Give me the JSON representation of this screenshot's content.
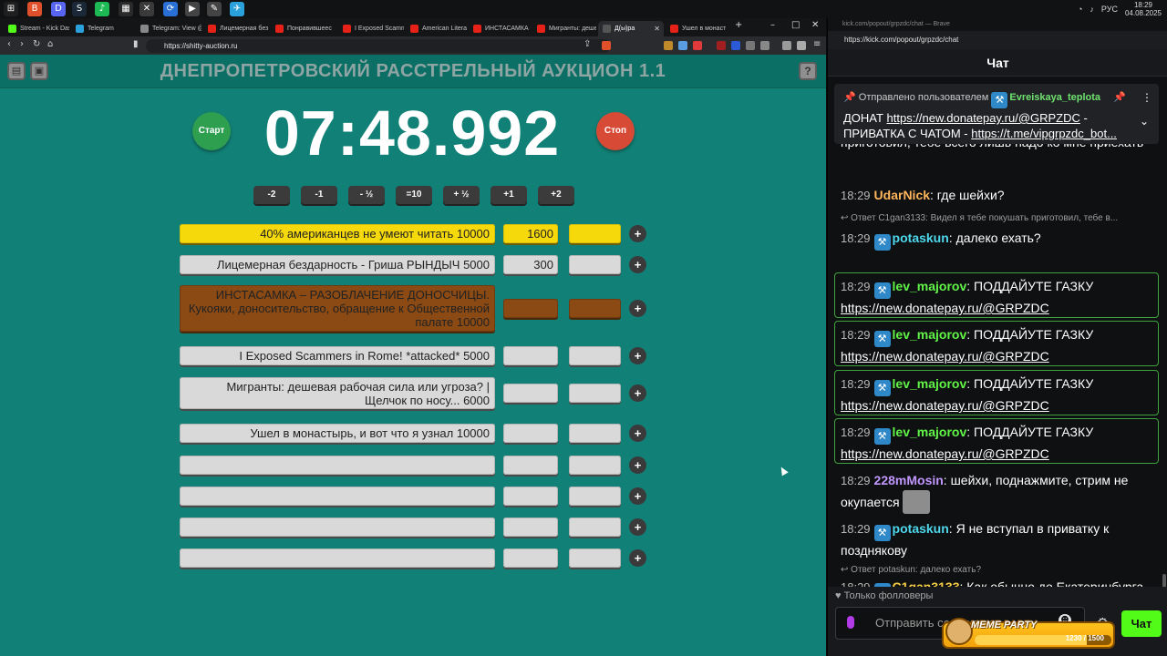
{
  "taskbar": {
    "apps": [
      {
        "name": "windows-start",
        "glyph": "⊞",
        "color": "#1f1f1f"
      },
      {
        "name": "brave",
        "glyph": "B",
        "color": "#e0502a"
      },
      {
        "name": "discord",
        "glyph": "D",
        "color": "#5865f2"
      },
      {
        "name": "steam",
        "glyph": "S",
        "color": "#1b2838"
      },
      {
        "name": "spotify",
        "glyph": "♪",
        "color": "#1db954"
      },
      {
        "name": "app",
        "glyph": "▦",
        "color": "#2a2a2a"
      },
      {
        "name": "app",
        "glyph": "✕",
        "color": "#3a3a3a"
      },
      {
        "name": "app",
        "glyph": "⟳",
        "color": "#2a6fd6"
      },
      {
        "name": "app",
        "glyph": "▶",
        "color": "#444"
      },
      {
        "name": "app",
        "glyph": "✎",
        "color": "#444"
      },
      {
        "name": "telegram",
        "glyph": "✈",
        "color": "#2aa1da"
      }
    ],
    "lang": "РУС",
    "time": "18:29",
    "date": "04.08.2025"
  },
  "browser": {
    "tabs": [
      {
        "label": "Stream - Kick Dash",
        "color": "#53fc18"
      },
      {
        "label": "Telegram",
        "color": "#2aa1da"
      },
      {
        "label": "Telegram: View @",
        "color": "#888"
      },
      {
        "label": "Лицемерная без",
        "color": "#e62117"
      },
      {
        "label": "Понравившеес",
        "color": "#e62117"
      },
      {
        "label": "I Exposed Scamm",
        "color": "#e62117"
      },
      {
        "label": "American Literacy",
        "color": "#e62117"
      },
      {
        "label": "ИНСТАСАМКА -",
        "color": "#e62117"
      },
      {
        "label": "Мигранты: деше",
        "color": "#e62117"
      },
      {
        "label": "Д(ы)ра",
        "color": "#555"
      },
      {
        "label": "Ушел в монасты",
        "color": "#e62117"
      }
    ],
    "url": "https://shitty-auction.ru"
  },
  "auction": {
    "title": "ДНЕПРОПЕТРОВСКИЙ РАССТРЕЛЬНЫЙ АУКЦИОН 1.1",
    "help": "?",
    "start": "Старт",
    "stop": "Стоп",
    "timer": "07:48.992",
    "adjust": [
      "-2",
      "-1",
      "- ½",
      "=10",
      "+ ½",
      "+1",
      "+2"
    ],
    "lots": [
      {
        "name": "40% американцев не умеют читать 10000",
        "amount": "1600",
        "style": "gold"
      },
      {
        "name": "Лицемерная бездарность - Гриша РЫНДЫЧ 5000",
        "amount": "300",
        "style": "plain"
      },
      {
        "name": "ИНСТАСАМКА – РАЗОБЛАЧЕНИЕ ДОНОСЧИЦЫ. Кукояки, доносительство, обращение к Общественной палате 10000",
        "amount": "",
        "style": "brown"
      },
      {
        "name": "I Exposed Scammers in Rome! *attacked* 5000",
        "amount": "",
        "style": "plain"
      },
      {
        "name": "Мигранты: дешевая рабочая сила или угроза? | Щелчок по носу... 6000",
        "amount": "",
        "style": "plain"
      },
      {
        "name": "Ушел в монастырь, и вот что я узнал 10000",
        "amount": "",
        "style": "plain"
      },
      {
        "name": "",
        "amount": "",
        "style": "plain"
      },
      {
        "name": "",
        "amount": "",
        "style": "plain"
      },
      {
        "name": "",
        "amount": "",
        "style": "plain"
      },
      {
        "name": "",
        "amount": "",
        "style": "plain"
      }
    ],
    "plus": "+"
  },
  "chat": {
    "window_title": "kick.com/popout/grpzdc/chat — Brave",
    "url": "https://kick.com/popout/grpzdc/chat",
    "header": "Чат",
    "pinned": {
      "prefix": "Отправлено пользователем",
      "user": "Evreiskaya_teplota",
      "text1": "ДОНАТ ",
      "link1": "https://new.donatepay.ru/@GRPZDC",
      "text2": " - ПРИВАТКА С ЧАТОМ - ",
      "link2": "https://t.me/vipgrpzdc_bot..."
    },
    "messages": [
      {
        "kind": "cont",
        "text": "приготовил, тебе всего лишь надо ко мне приехать"
      },
      {
        "time": "18:29",
        "user": "UdarNick",
        "color": "#ffb65c",
        "text": "где шейхи?"
      },
      {
        "kind": "reply",
        "text": "Ответ C1gan3133: Видел я тебе покушать приготовил, тебе в..."
      },
      {
        "time": "18:29",
        "user": "potaskun",
        "color": "#4dd8ee",
        "text": "далеко ехать?"
      },
      {
        "time": "18:29",
        "user": "lev_majorov",
        "color": "#61f548",
        "text": "ПОДДАЙУТЕ ГАЗКУ",
        "link": "https://new.donatepay.ru/@GRPZDC"
      },
      {
        "time": "18:29",
        "user": "lev_majorov",
        "color": "#61f548",
        "text": "ПОДДАЙУТЕ ГАЗКУ",
        "link": "https://new.donatepay.ru/@GRPZDC"
      },
      {
        "time": "18:29",
        "user": "lev_majorov",
        "color": "#61f548",
        "text": "ПОДДАЙУТЕ ГАЗКУ",
        "link": "https://new.donatepay.ru/@GRPZDC"
      },
      {
        "time": "18:29",
        "user": "lev_majorov",
        "color": "#61f548",
        "text": "ПОДДАЙУТЕ ГАЗКУ",
        "link": "https://new.donatepay.ru/@GRPZDC"
      },
      {
        "time": "18:29",
        "user": "228mMosin",
        "color": "#c197ff",
        "text": "шейхи, поднажмите, стрим не окупается"
      },
      {
        "time": "18:29",
        "user": "potaskun",
        "color": "#4dd8ee",
        "text": "Я не вступал в приватку к позднякову"
      },
      {
        "kind": "reply",
        "text": "Ответ potaskun: далеко ехать?"
      },
      {
        "time": "18:29",
        "user": "C1gan3133",
        "color": "#f7cf45",
        "text": "Как обычно до Екатеринбурга"
      }
    ],
    "followers_only": "Только фолловеры",
    "input_placeholder": "Отправить сообщение",
    "send": "Чат",
    "meme_title": "MEME PARTY",
    "meme_count": "1230 / 1500",
    "meme_progress": 0.82
  }
}
